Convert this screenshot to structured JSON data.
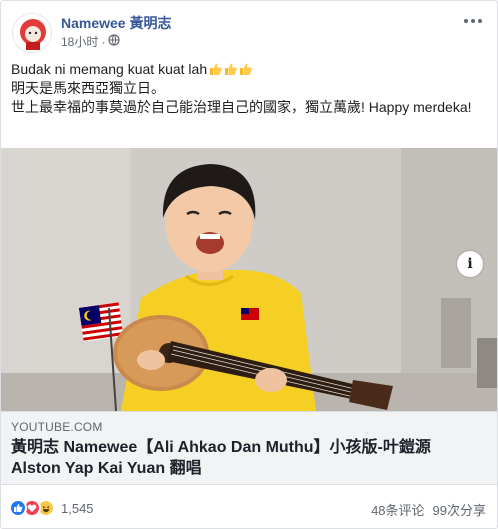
{
  "post": {
    "author": "Namewee 黃明志",
    "time": "18小时",
    "privacy_icon": "globe-icon",
    "menu_icon": "more-dots-icon",
    "caption_lines": [
      "Budak ni memang kuat kuat lah",
      "明天是馬來西亞獨立日。",
      "世上最幸福的事莫過於自己能治理自己的國家，獨立萬歲! Happy merdeka!"
    ],
    "caption_emoji": "thumbs-up-icon"
  },
  "link": {
    "domain": "YOUTUBE.COM",
    "title": "黃明志 Namewee【Ali Ahkao Dan Muthu】小孩版-叶鎧源 Alston Yap Kai Yuan 翻唱",
    "info_icon": "info-icon"
  },
  "footer": {
    "reaction_icons": [
      "like-icon",
      "love-icon",
      "haha-icon"
    ],
    "reaction_count": "1,545",
    "comments": "48条评论",
    "shares": "99次分享"
  },
  "colors": {
    "author": "#385898",
    "like": "#2078f4",
    "love": "#f33e58",
    "haha": "#f7c949",
    "link_bg": "#f2f3f5"
  }
}
